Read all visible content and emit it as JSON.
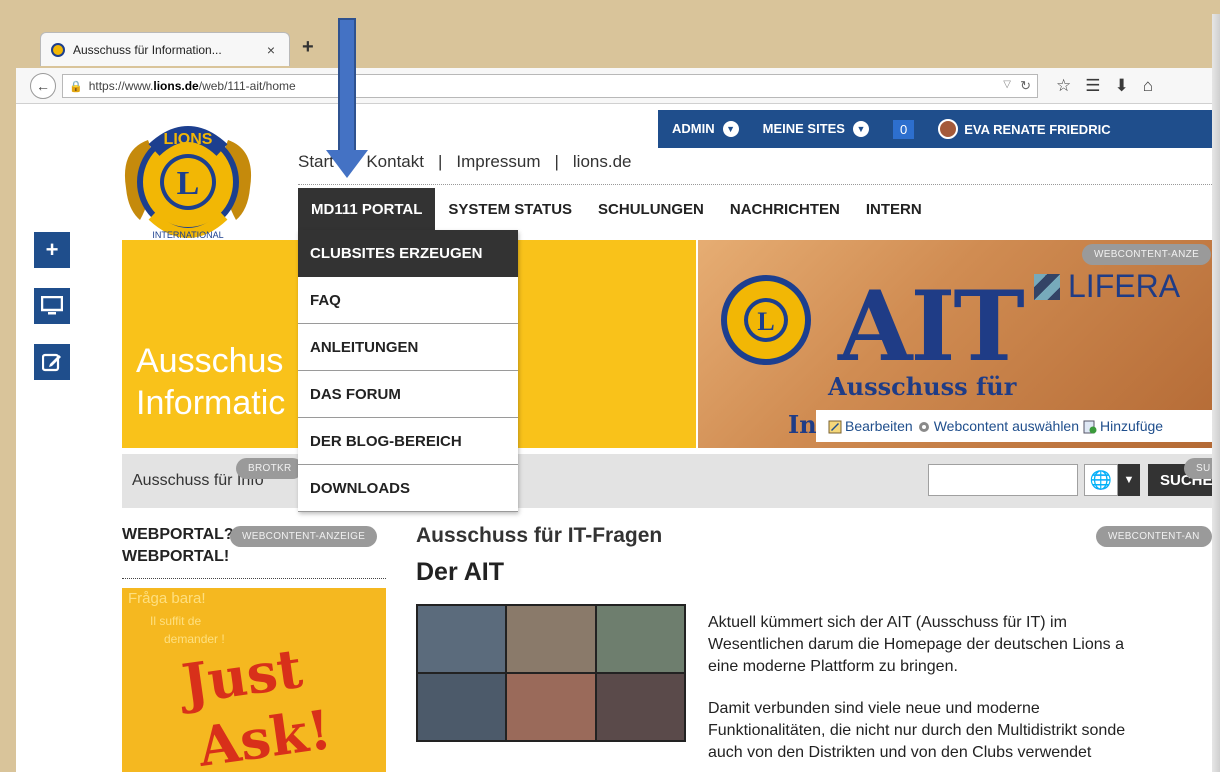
{
  "browser": {
    "tab_title": "Ausschuss für Information...",
    "tab_close": "×",
    "new_tab": "+",
    "url_prefix": "https://www.",
    "url_domain": "lions.de",
    "url_path": "/web/111-ait/home"
  },
  "admin_bar": {
    "admin": "ADMIN",
    "my_sites": "MEINE SITES",
    "notification_count": "0",
    "user": "EVA RENATE FRIEDRIC"
  },
  "top_links": [
    "Start",
    "Kontakt",
    "Impressum",
    "lions.de"
  ],
  "main_nav": [
    "MD111 PORTAL",
    "SYSTEM STATUS",
    "SCHULUNGEN",
    "NACHRICHTEN",
    "INTERN"
  ],
  "dropdown": [
    "CLUBSITES ERZEUGEN",
    "FAQ",
    "ANLEITUNGEN",
    "DAS FORUM",
    "DER BLOG-BEREICH",
    "DOWNLOADS"
  ],
  "banner": {
    "title_line1": "Ausschus",
    "title_line2": "Informatic",
    "webcontent_tag": "WEBCONTENT-ANZE",
    "liferay": "LIFERA",
    "ait": "AIT",
    "ausschuss_fuer": "Ausschuss für",
    "in_text": "In",
    "edit": "Bearbeiten",
    "select_content": "Webcontent auswählen",
    "add": "Hinzufüge"
  },
  "breadcrumb": {
    "text": "Ausschuss für Info",
    "tag": "BROTKR"
  },
  "search": {
    "button": "SUCHE",
    "tag": "SU"
  },
  "left_column": {
    "title_line1": "WEBPORTAL?",
    "title_line2": "WEBPORTAL!",
    "tag": "WEBCONTENT-ANZEIGE",
    "img_text1": "Fråga bara!",
    "img_text2": "Il suffit de",
    "img_text3": "demander !",
    "img_big1": "Just",
    "img_big2": "Ask!"
  },
  "right_column": {
    "tag": "WEBCONTENT-AN",
    "heading": "Ausschuss für IT-Fragen",
    "subheading": "Der AIT",
    "para1_line1": "Aktuell kümmert sich der AIT (Ausschuss für IT) im",
    "para1_line2": "Wesentlichen darum die Homepage der deutschen Lions a",
    "para1_line3": "eine moderne Plattform zu bringen.",
    "para2_line1": "Damit verbunden sind viele neue und moderne",
    "para2_line2": "Funktionalitäten, die nicht nur durch den Multidistrikt sonde",
    "para2_line3": "auch von den Distrikten und von den Clubs verwendet"
  },
  "colors": {
    "brand_blue": "#1f4e8c",
    "banner_yellow": "#f9c21a",
    "nav_dark": "#333333",
    "arrow_blue": "#4472c4"
  }
}
